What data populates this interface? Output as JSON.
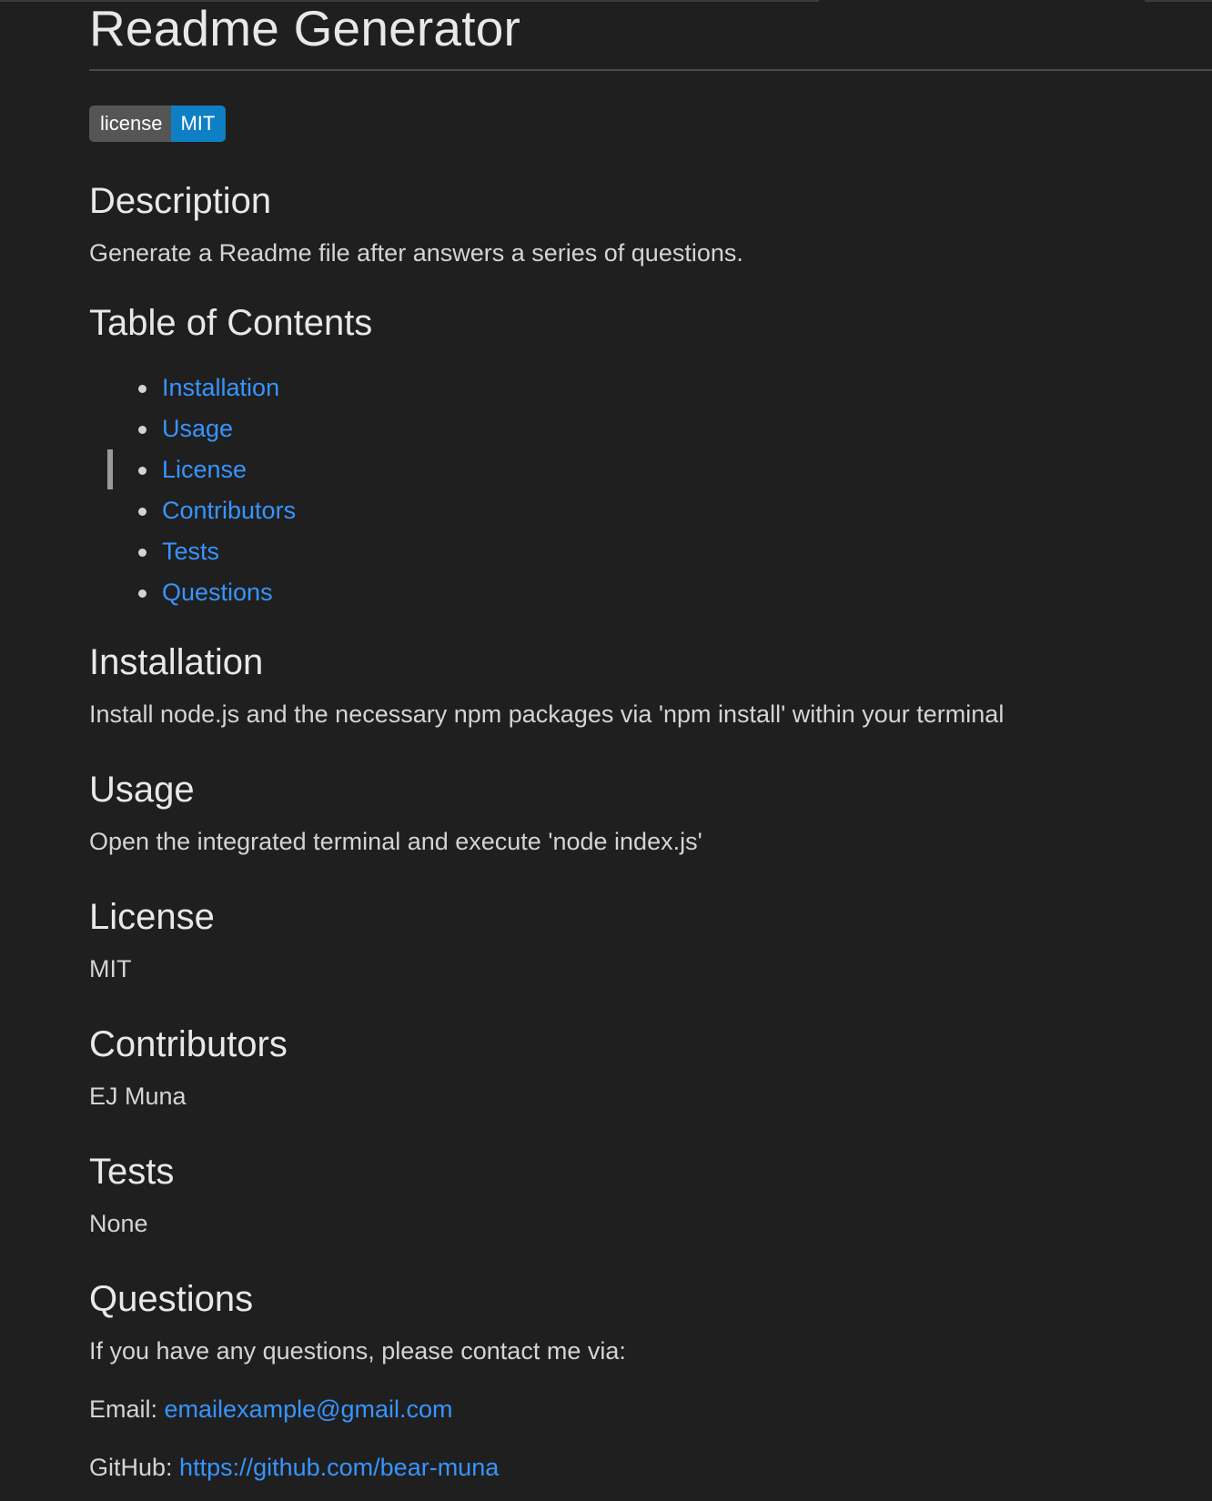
{
  "document": {
    "title": "Readme Generator",
    "badge": {
      "label": "license",
      "value": "MIT"
    },
    "description": {
      "heading": "Description",
      "text": "Generate a Readme file after answers a series of questions."
    },
    "toc": {
      "heading": "Table of Contents",
      "items": [
        "Installation",
        "Usage",
        "License",
        "Contributors",
        "Tests",
        "Questions"
      ]
    },
    "installation": {
      "heading": "Installation",
      "text": "Install node.js and the necessary npm packages via 'npm install' within your terminal"
    },
    "usage": {
      "heading": "Usage",
      "text": "Open the integrated terminal and execute 'node index.js'"
    },
    "license": {
      "heading": "License",
      "text": "MIT"
    },
    "contributors": {
      "heading": "Contributors",
      "text": "EJ Muna"
    },
    "tests": {
      "heading": "Tests",
      "text": "None"
    },
    "questions": {
      "heading": "Questions",
      "intro": "If you have any questions, please contact me via:",
      "email_label": "Email: ",
      "email": "emailexample@gmail.com",
      "github_label": "GitHub: ",
      "github": "https://github.com/bear-muna"
    }
  },
  "colors": {
    "background": "#1f1f1f",
    "link": "#3794ff",
    "badge_label_bg": "#555555",
    "badge_value_bg": "#0e7fc4"
  }
}
